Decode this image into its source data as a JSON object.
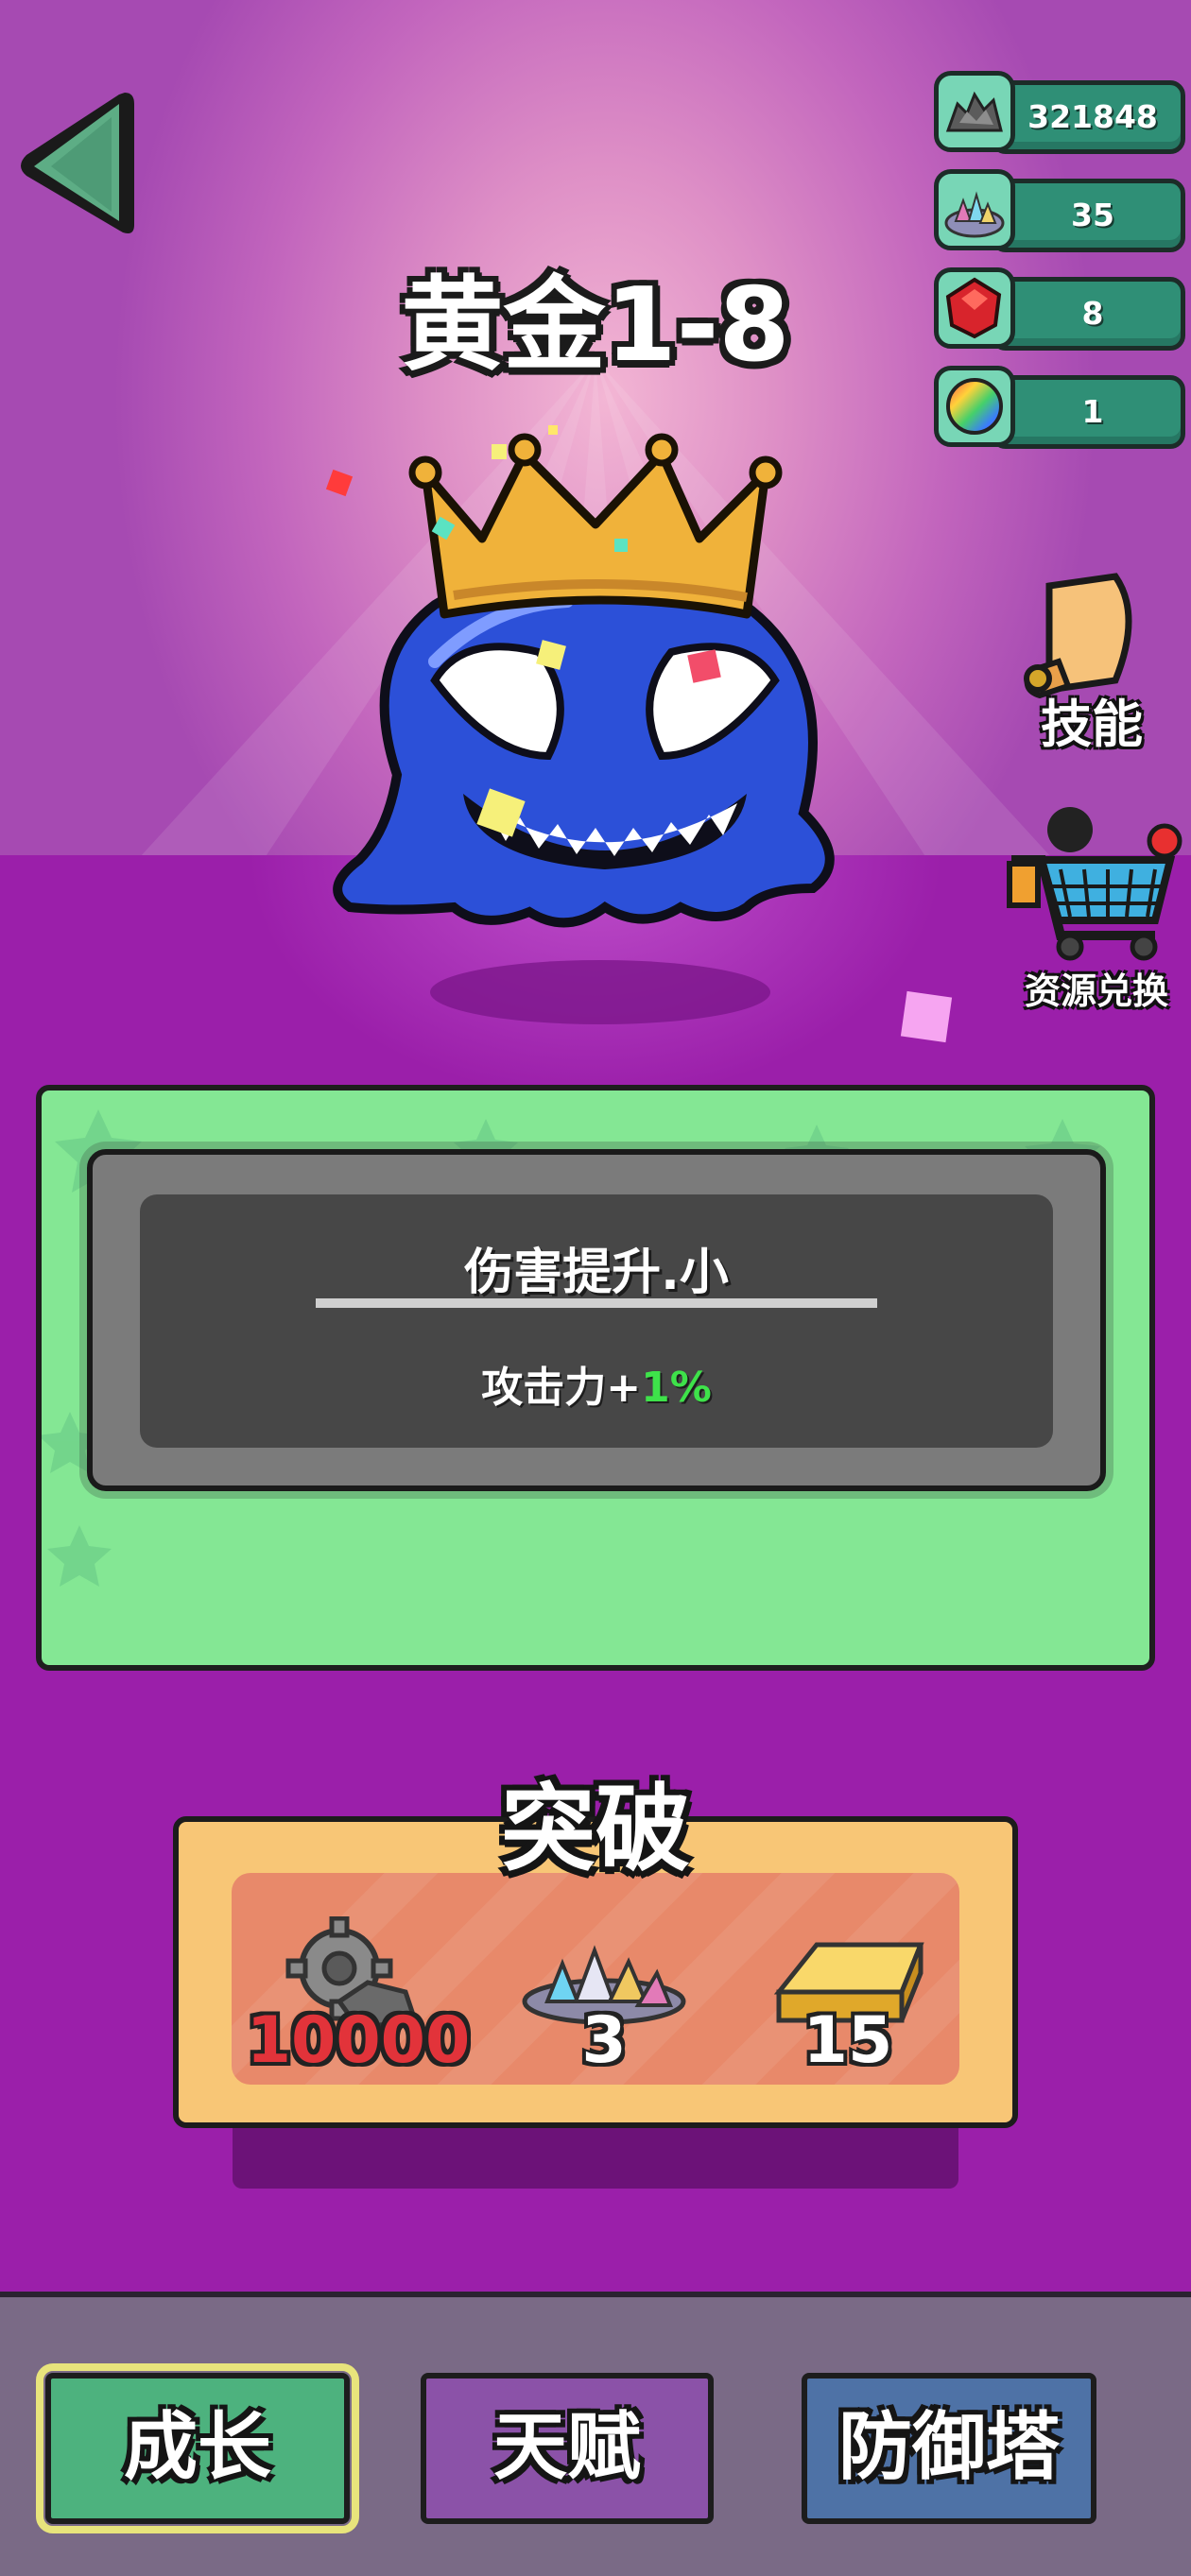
{
  "header": {
    "title": "黄金1-8"
  },
  "resources": [
    {
      "icon": "scrap-metal-icon",
      "value": "321848"
    },
    {
      "icon": "crystal-pile-icon",
      "value": "35"
    },
    {
      "icon": "red-gem-icon",
      "value": "8"
    },
    {
      "icon": "rainbow-orb-icon",
      "value": "1"
    }
  ],
  "side_buttons": {
    "skills_label": "技能",
    "exchange_label": "资源兑换"
  },
  "upgrade_card": {
    "name": "伤害提升.小",
    "stat_label": "攻击力+",
    "stat_value": "1%"
  },
  "breakthrough": {
    "title": "突破",
    "costs": [
      {
        "icon": "gear-scrap-icon",
        "amount": "10000",
        "insufficient": true
      },
      {
        "icon": "crystal-pile-icon",
        "amount": "3",
        "insufficient": false
      },
      {
        "icon": "gold-bar-icon",
        "amount": "15",
        "insufficient": false
      }
    ]
  },
  "bottom_nav": {
    "tabs": [
      {
        "label": "成长",
        "active": true
      },
      {
        "label": "天赋",
        "active": false
      },
      {
        "label": "防御塔",
        "active": false
      }
    ]
  },
  "colors": {
    "accent_green": "#84e794",
    "floor_purple": "#9b1faa",
    "stat_green": "#3ee24a",
    "insufficient_red": "#e2333a"
  }
}
